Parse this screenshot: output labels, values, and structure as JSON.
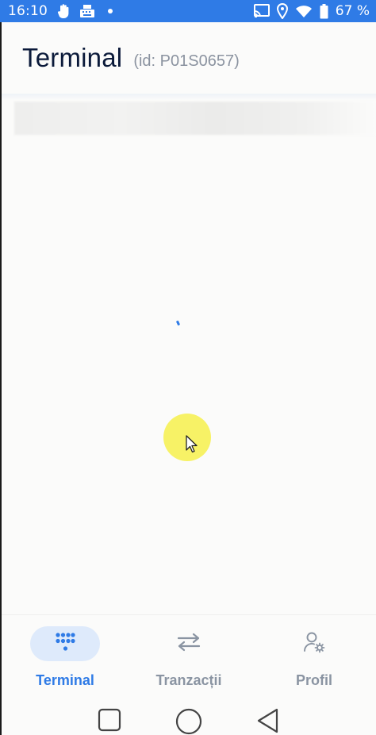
{
  "status_bar": {
    "time": "16:10",
    "battery_percent": "67 %",
    "icons": [
      "hand-icon",
      "keyboard-icon",
      "cast-icon",
      "location-icon",
      "wifi-icon",
      "battery-icon"
    ]
  },
  "header": {
    "title": "Terminal",
    "terminal_id": "(id: P01S0657)"
  },
  "colors": {
    "accent": "#2f7be6",
    "active_pill": "#deeafb",
    "inactive": "#8a94a2",
    "title": "#0b1a3a",
    "touch_indicator": "#f7f266"
  },
  "bottom_nav": {
    "items": [
      {
        "label": "Terminal",
        "icon": "keypad-icon",
        "active": true
      },
      {
        "label": "Tranzacții",
        "icon": "transfer-arrows-icon",
        "active": false
      },
      {
        "label": "Profil",
        "icon": "user-settings-icon",
        "active": false
      }
    ]
  },
  "system_nav": [
    "recents-icon",
    "home-icon",
    "back-icon"
  ]
}
